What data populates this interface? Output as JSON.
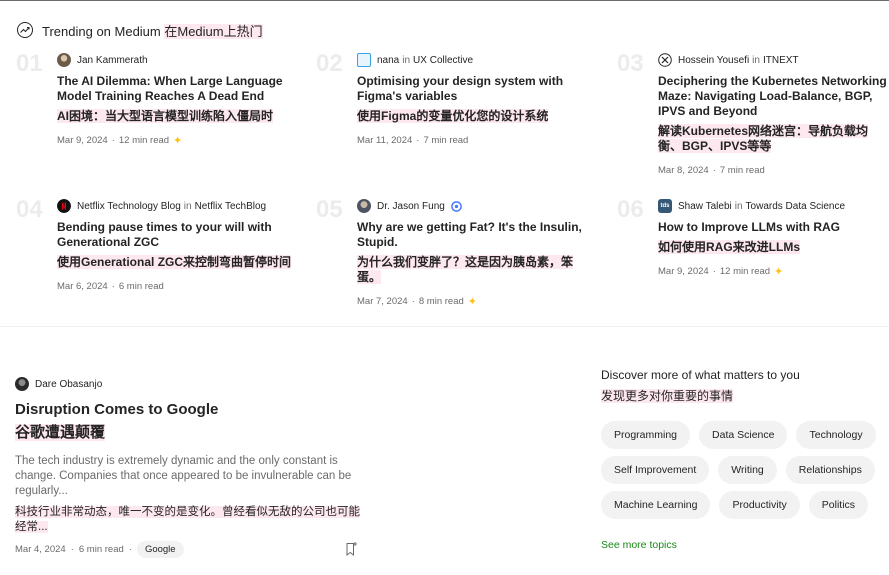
{
  "trending": {
    "heading": "Trending on Medium",
    "heading_cn": "在Medium上热门",
    "items": [
      {
        "num": "01",
        "author": "Jan Kammerath",
        "in_word": "",
        "publication": "",
        "title": "The AI Dilemma: When Large Language Model Training Reaches A Dead End",
        "title_cn": "AI困境：当大型语言模型训练陷入僵局时",
        "date": "Mar 9, 2024",
        "read": "12 min read",
        "member": true
      },
      {
        "num": "02",
        "author": "nana",
        "in_word": "in",
        "publication": "UX Collective",
        "title": "Optimising your design system with Figma's variables",
        "title_cn": "使用Figma的变量优化您的设计系统",
        "date": "Mar 11, 2024",
        "read": "7 min read",
        "member": false
      },
      {
        "num": "03",
        "author": "Hossein Yousefi",
        "in_word": "in",
        "publication": "ITNEXT",
        "title": "Deciphering the Kubernetes Networking Maze: Navigating Load-Balance, BGP, IPVS and Beyond",
        "title_cn": "解读Kubernetes网络迷宫：导航负载均衡、BGP、IPVS等等",
        "date": "Mar 8, 2024",
        "read": "7 min read",
        "member": false
      },
      {
        "num": "04",
        "author": "Netflix Technology Blog",
        "in_word": "in",
        "publication": "Netflix TechBlog",
        "title": "Bending pause times to your will with Generational ZGC",
        "title_cn": "使用Generational ZGC来控制弯曲暂停时间",
        "date": "Mar 6, 2024",
        "read": "6 min read",
        "member": false
      },
      {
        "num": "05",
        "author": "Dr. Jason Fung",
        "in_word": "",
        "publication": "",
        "title": "Why are we getting Fat? It's the Insulin, Stupid.",
        "title_cn": "为什么我们变胖了？这是因为胰岛素，笨蛋。",
        "date": "Mar 7, 2024",
        "read": "8 min read",
        "member": true
      },
      {
        "num": "06",
        "author": "Shaw Talebi",
        "in_word": "in",
        "publication": "Towards Data Science",
        "title": "How to Improve LLMs with RAG",
        "title_cn": "如何使用RAG来改进LLMs",
        "date": "Mar 9, 2024",
        "read": "12 min read",
        "member": true
      }
    ]
  },
  "featured": {
    "author": "Dare Obasanjo",
    "title": "Disruption Comes to Google",
    "title_cn": "谷歌遭遇颠覆",
    "desc": "The tech industry is extremely dynamic and the only constant is change. Companies that once appeared to be invulnerable can be regularly...",
    "desc_cn": "科技行业非常动态，唯一不变的是变化。曾经看似无敌的公司也可能经常...",
    "date": "Mar 4, 2024",
    "read": "6 min read",
    "tag": "Google"
  },
  "discover": {
    "heading": "Discover more of what matters to you",
    "heading_cn": "发现更多对你重要的事情",
    "topics": [
      [
        "Programming",
        "Data Science",
        "Technology"
      ],
      [
        "Self Improvement",
        "Writing",
        "Relationships"
      ],
      [
        "Machine Learning",
        "Productivity",
        "Politics"
      ]
    ],
    "see_more": "See more topics"
  },
  "separator": "·",
  "colors": {
    "accent_green": "#1a8917",
    "highlight": "#fde8ef",
    "member_star": "#ffc017",
    "number_grey": "#ececec"
  }
}
